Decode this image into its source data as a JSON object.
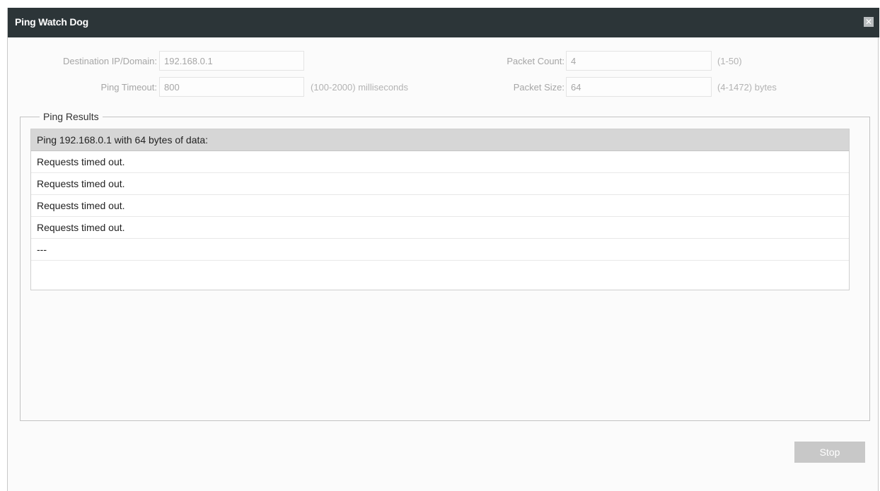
{
  "dialog": {
    "title": "Ping Watch Dog",
    "close_icon": "close-icon"
  },
  "form": {
    "destination": {
      "label": "Destination IP/Domain:",
      "value": "192.168.0.1"
    },
    "timeout": {
      "label": "Ping Timeout:",
      "value": "800",
      "hint": "(100-2000) milliseconds"
    },
    "count": {
      "label": "Packet Count:",
      "value": "4",
      "hint": "(1-50)"
    },
    "size": {
      "label": "Packet Size:",
      "value": "64",
      "hint": "(4-1472) bytes"
    }
  },
  "results": {
    "legend": "Ping Results",
    "header": "Ping 192.168.0.1 with 64 bytes of data:",
    "rows": [
      "Requests timed out.",
      "Requests timed out.",
      "Requests timed out.",
      "Requests timed out.",
      "---",
      ""
    ]
  },
  "actions": {
    "stop_label": "Stop"
  }
}
